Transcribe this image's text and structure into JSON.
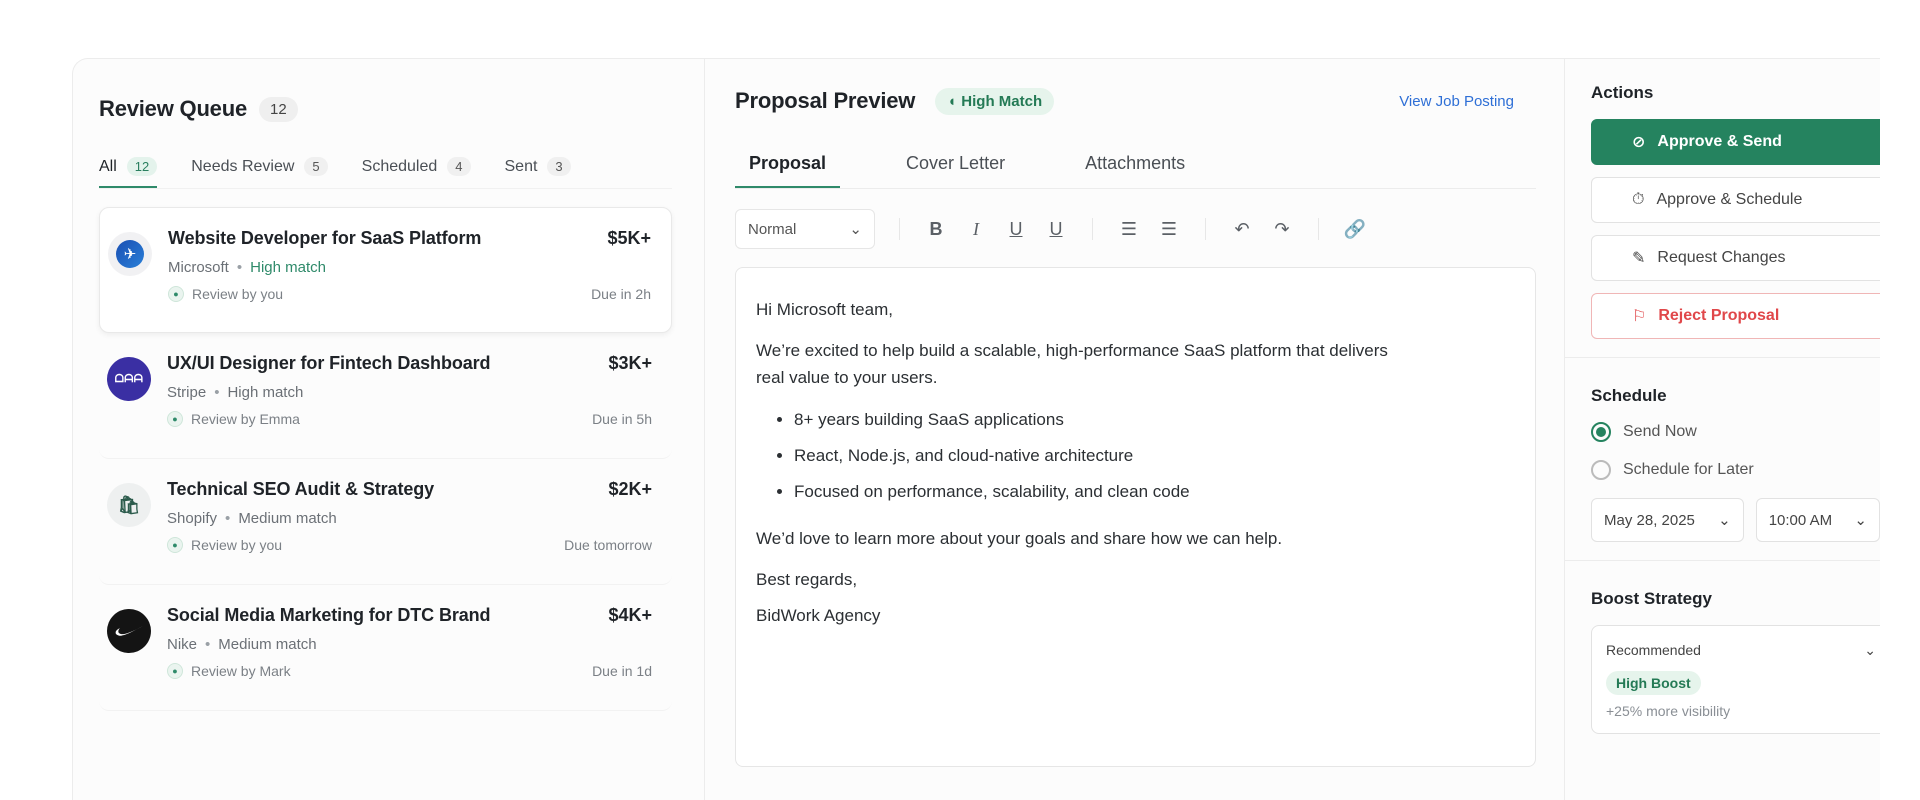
{
  "queue": {
    "title": "Review Queue",
    "count": "12",
    "tabs": [
      {
        "label": "All",
        "count": "12"
      },
      {
        "label": "Needs Review",
        "count": "5"
      },
      {
        "label": "Scheduled",
        "count": "4"
      },
      {
        "label": "Sent",
        "count": "3"
      }
    ],
    "items": [
      {
        "title": "Website Developer for SaaS Platform",
        "budget": "$5K+",
        "company": "Microsoft",
        "match": "High match",
        "reviewer": "Review by you",
        "due": "Due in 2h",
        "logo": "microsoft-logo",
        "logo_text": "✈"
      },
      {
        "title": "UX/UI Designer for Fintech Dashboard",
        "budget": "$3K+",
        "company": "Stripe",
        "match": "High match",
        "reviewer": "Review by Emma",
        "due": "Due in 5h",
        "logo": "stripe-logo",
        "logo_text": "ᗝᗩᗩ"
      },
      {
        "title": "Technical SEO Audit & Strategy",
        "budget": "$2K+",
        "company": "Shopify",
        "match": "Medium match",
        "reviewer": "Review by you",
        "due": "Due tomorrow",
        "logo": "shopify-logo",
        "logo_text": "🛍"
      },
      {
        "title": "Social Media Marketing for DTC Brand",
        "budget": "$4K+",
        "company": "Nike",
        "match": "Medium match",
        "reviewer": "Review by Mark",
        "due": "Due in 1d",
        "logo": "nike-logo",
        "logo_text": ""
      }
    ]
  },
  "preview": {
    "title": "Proposal Preview",
    "badge": "High Match",
    "link": "View Job Posting",
    "tabs": [
      "Proposal",
      "Cover Letter",
      "Attachments"
    ],
    "style_select": "Normal",
    "body": {
      "greeting": "Hi Microsoft team,",
      "intro": "We’re excited to help build a scalable, high-performance SaaS platform that delivers real value to your users.",
      "bullets": [
        "8+ years building SaaS applications",
        "React, Node.js, and cloud-native architecture",
        "Focused on performance, scalability, and clean code"
      ],
      "closing": "We’d love to learn more about your goals and share how we can help.",
      "signoff": "Best regards,",
      "signature": "BidWork Agency"
    }
  },
  "actions": {
    "title": "Actions",
    "approve_send": "Approve & Send",
    "approve_schedule": "Approve & Schedule",
    "request_changes": "Request Changes",
    "reject": "Reject Proposal"
  },
  "schedule": {
    "title": "Schedule",
    "send_now": "Send Now",
    "schedule_later": "Schedule for Later",
    "date": "May 28, 2025",
    "time": "10:00 AM"
  },
  "boost": {
    "title": "Boost Strategy",
    "selected": "Recommended",
    "badge": "High Boost",
    "note": "+25% more visibility"
  },
  "colors": {
    "accent": "#25835f",
    "danger": "#e0474a",
    "link": "#2e6fd6"
  }
}
